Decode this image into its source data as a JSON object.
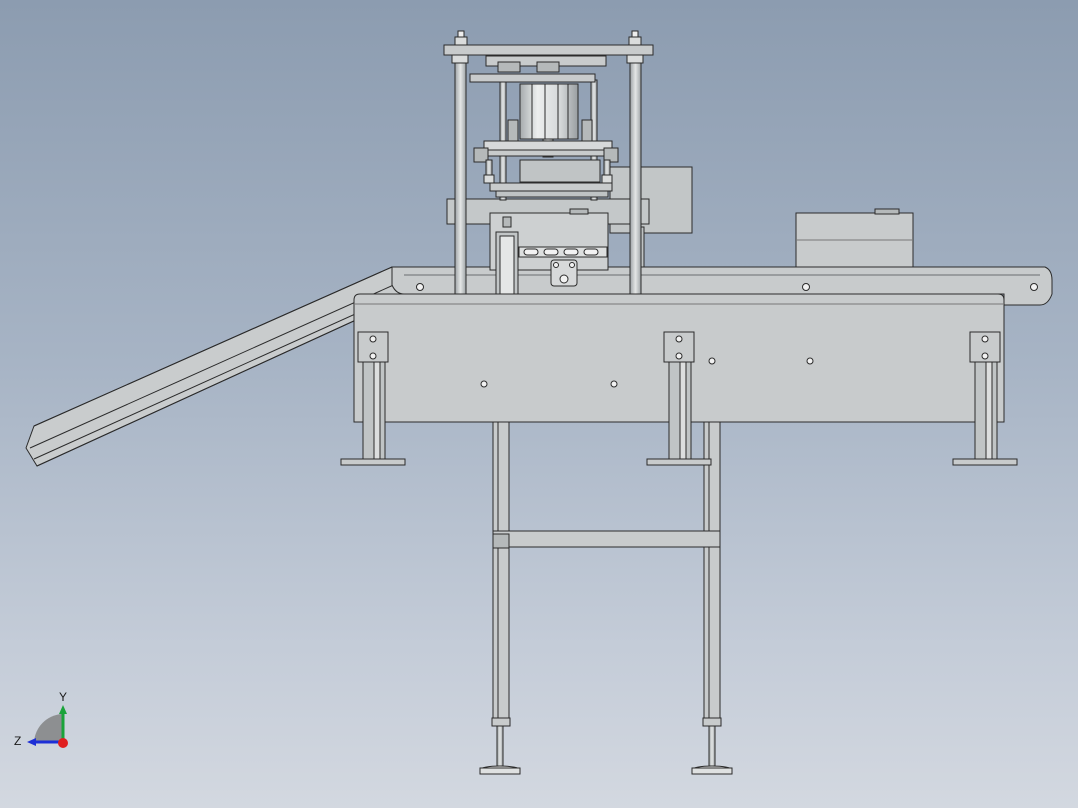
{
  "viewport": {
    "background_top": "#8c9cb0",
    "background_bottom": "#d3d8e0",
    "model_fill": "#c8cbcc",
    "model_shade": "#a9adae",
    "model_edge": "#2b2b2b"
  },
  "triad": {
    "y_label": "Y",
    "z_label": "Z",
    "y_color": "#1aa33a",
    "z_color": "#1d2fd6",
    "x_color": "#e01f1f"
  }
}
